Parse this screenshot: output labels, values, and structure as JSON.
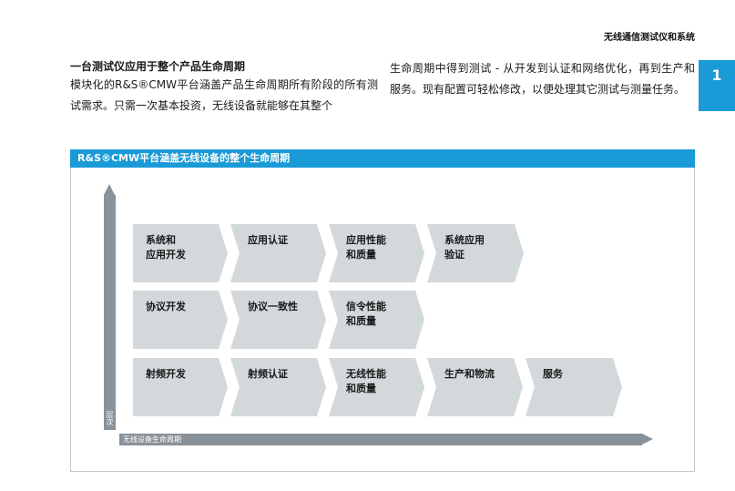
{
  "header": {
    "title": "无线通信测试仪和系统",
    "chapter": "1"
  },
  "intro": {
    "heading": "一台测试仪应用于整个产品生命周期",
    "col1": "模块化的R&S®CMW平台涵盖产品生命周期所有阶段的所有测试需求。只需一次基本投资，无线设备就能够在其整个",
    "col2": "生命周期中得到测试 - 从开发到认证和网络优化，再到生产和服务。现有配置可轻松修改，以便处理其它测试与测量任务。"
  },
  "figure": {
    "title": "R&S®CMW平台涵盖无线设备的整个生命周期",
    "y_axis_label": "层次",
    "x_axis_label": "无线设备生命周期",
    "rows": [
      [
        "系统和\n应用开发",
        "应用认证",
        "应用性能\n和质量",
        "系统应用\n验证"
      ],
      [
        "协议开发",
        "协议一致性",
        "信令性能\n和质量"
      ],
      [
        "射频开发",
        "射频认证",
        "无线性能\n和质量",
        "生产和物流",
        "服务"
      ]
    ]
  }
}
